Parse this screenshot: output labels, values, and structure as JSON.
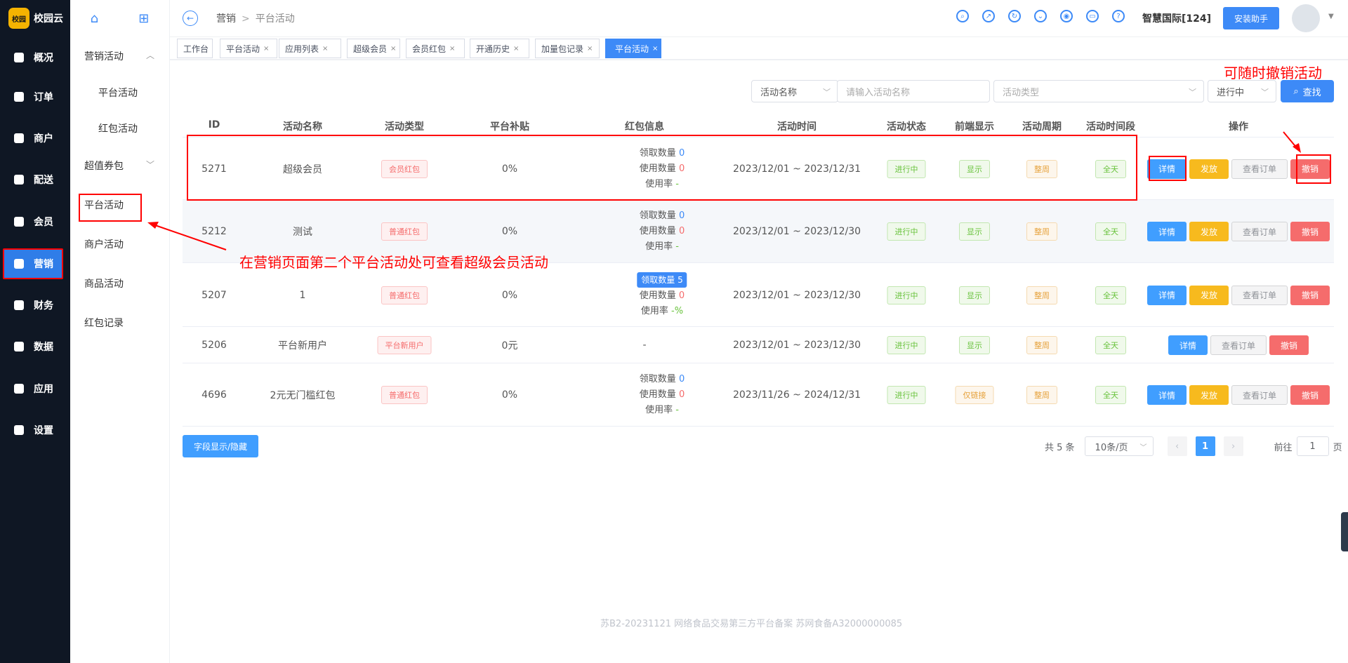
{
  "logo": {
    "mark": "校园",
    "text": "校园云"
  },
  "main_nav": [
    {
      "label": "概况",
      "icon": "dashboard-icon"
    },
    {
      "label": "订单",
      "icon": "order-icon"
    },
    {
      "label": "商户",
      "icon": "store-icon"
    },
    {
      "label": "配送",
      "icon": "delivery-icon"
    },
    {
      "label": "会员",
      "icon": "member-icon"
    },
    {
      "label": "营销",
      "icon": "marketing-icon",
      "active": true
    },
    {
      "label": "财务",
      "icon": "finance-icon"
    },
    {
      "label": "数据",
      "icon": "data-icon"
    },
    {
      "label": "应用",
      "icon": "app-icon"
    },
    {
      "label": "设置",
      "icon": "settings-icon"
    }
  ],
  "sub_nav": {
    "items": [
      {
        "label": "营销活动",
        "type": "group",
        "arrow": "︿"
      },
      {
        "label": "平台活动",
        "type": "child"
      },
      {
        "label": "红包活动",
        "type": "child"
      },
      {
        "label": "超值券包",
        "type": "group",
        "arrow": "﹀"
      },
      {
        "label": "平台活动",
        "type": "group"
      },
      {
        "label": "商户活动",
        "type": "group"
      },
      {
        "label": "商品活动",
        "type": "group"
      },
      {
        "label": "红包记录",
        "type": "group"
      }
    ]
  },
  "header": {
    "breadcrumb": [
      "营销",
      "平台活动"
    ],
    "org_name": "智慧国际[124]",
    "install_label": "安装助手"
  },
  "tabs": [
    {
      "label": "工作台",
      "closable": false
    },
    {
      "label": "平台活动",
      "closable": true
    },
    {
      "label": "应用列表",
      "closable": true
    },
    {
      "label": "超级会员",
      "closable": true
    },
    {
      "label": "会员红包",
      "closable": true
    },
    {
      "label": "开通历史",
      "closable": true
    },
    {
      "label": "加量包记录",
      "closable": true
    },
    {
      "label": "平台活动",
      "closable": true,
      "active": true
    }
  ],
  "filters": {
    "field_select": "活动名称",
    "name_placeholder": "请输入活动名称",
    "type_placeholder": "活动类型",
    "status_select": "进行中",
    "search_label": "查找"
  },
  "annotations": {
    "left": "在营销页面第二个平台活动处可查看超级会员活动",
    "right": "可随时撤销活动"
  },
  "table": {
    "columns": [
      "ID",
      "活动名称",
      "活动类型",
      "平台补贴",
      "红包信息",
      "活动时间",
      "活动状态",
      "前端显示",
      "活动周期",
      "活动时间段",
      "操作"
    ],
    "hb_labels": {
      "claim": "领取数量",
      "used": "使用数量",
      "rate": "使用率"
    },
    "rows": [
      {
        "id": "5271",
        "name": "超级会员",
        "type": "会员红包",
        "subsidy": "0%",
        "hb": {
          "claim": "0",
          "used": "0",
          "rate": "-"
        },
        "time": "2023/12/01 ~ 2023/12/31",
        "status": "进行中",
        "display": "显示",
        "cycle": "整周",
        "period": "全天",
        "actions": [
          "详情",
          "发放",
          "查看订单",
          "撤销"
        ]
      },
      {
        "id": "5212",
        "name": "测试",
        "type": "普通红包",
        "subsidy": "0%",
        "hb": {
          "claim": "0",
          "used": "0",
          "rate": "-"
        },
        "time": "2023/12/01 ~ 2023/12/30",
        "status": "进行中",
        "display": "显示",
        "cycle": "整周",
        "period": "全天",
        "actions": [
          "详情",
          "发放",
          "查看订单",
          "撤销"
        ]
      },
      {
        "id": "5207",
        "name": "1",
        "type": "普通红包",
        "subsidy": "0%",
        "hb": {
          "claim_pill": "领取数量 5",
          "used": "0",
          "rate": "-%"
        },
        "time": "2023/12/01 ~ 2023/12/30",
        "status": "进行中",
        "display": "显示",
        "cycle": "整周",
        "period": "全天",
        "actions": [
          "详情",
          "发放",
          "查看订单",
          "撤销"
        ]
      },
      {
        "id": "5206",
        "name": "平台新用户",
        "type": "平台新用户",
        "subsidy": "0元",
        "hb_text": "-",
        "time": "2023/12/01 ~ 2023/12/30",
        "status": "进行中",
        "display": "显示",
        "cycle": "整周",
        "period": "全天",
        "actions": [
          "详情",
          "查看订单",
          "撤销"
        ]
      },
      {
        "id": "4696",
        "name": "2元无门槛红包",
        "type": "普通红包",
        "subsidy": "0%",
        "hb": {
          "claim": "0",
          "used": "0",
          "rate": "-"
        },
        "time": "2023/11/26 ~ 2024/12/31",
        "status": "进行中",
        "display": "仅链接",
        "cycle": "整周",
        "period": "全天",
        "actions": [
          "详情",
          "发放",
          "查看订单",
          "撤销"
        ]
      }
    ]
  },
  "footer": {
    "field_toggle": "字段显示/隐藏",
    "total": "共 5 条",
    "page_size": "10条/页",
    "current_page": "1",
    "goto_prefix": "前往",
    "goto_value": "1",
    "goto_suffix": "页",
    "icp": "苏B2-20231121   网络食品交易第三方平台备案 苏网食备A32000000085"
  },
  "colors": {
    "accent": "#3d8af7",
    "nav_bg": "#0f1724",
    "annotation": "#ff0000"
  }
}
